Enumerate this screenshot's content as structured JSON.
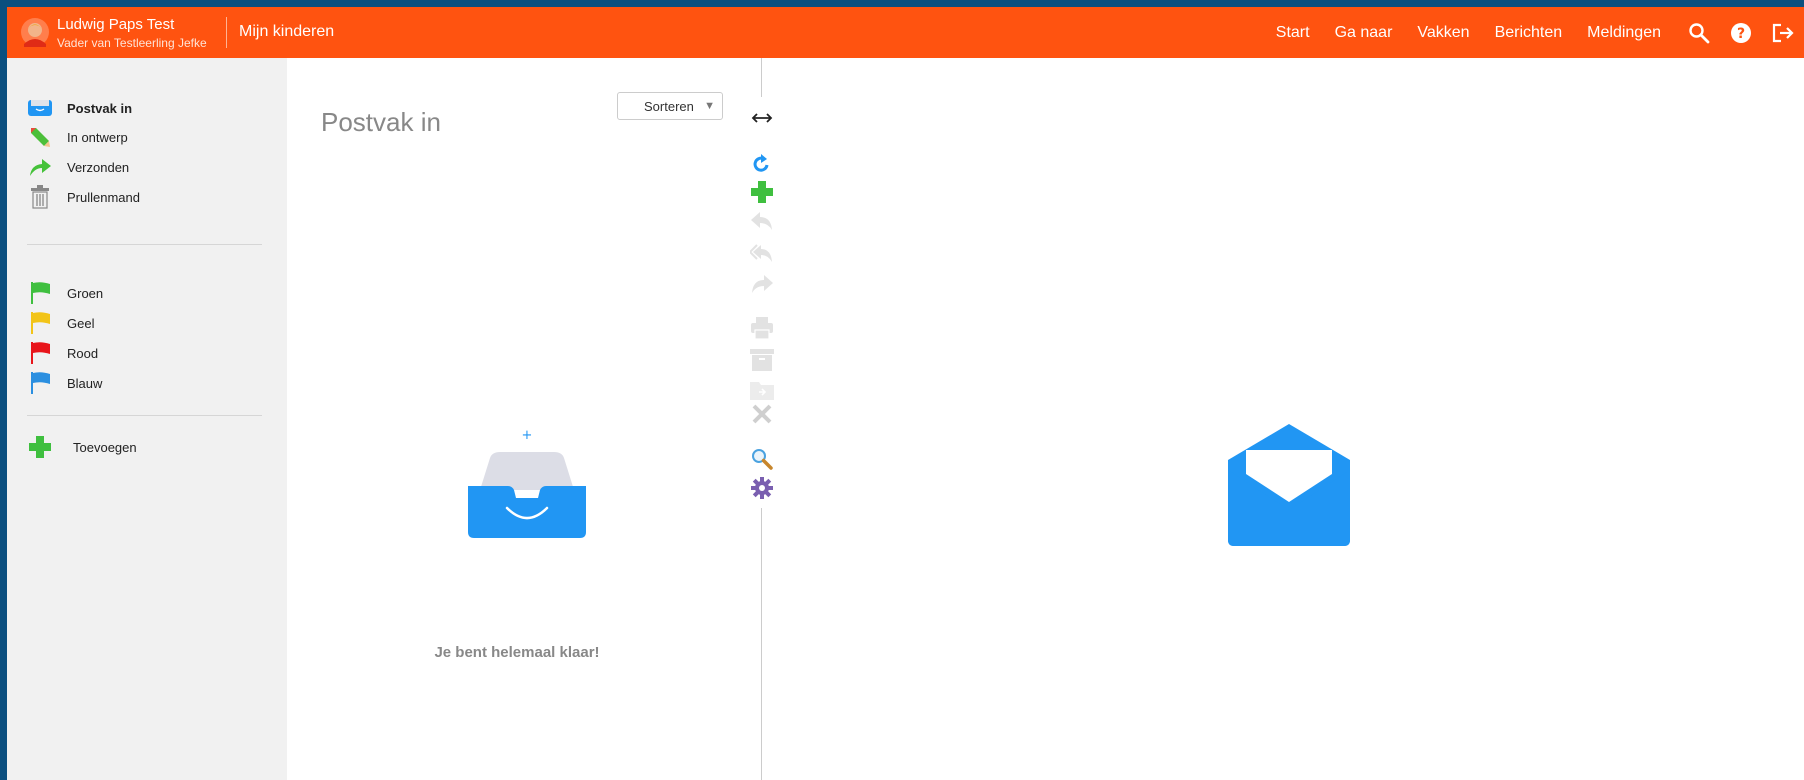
{
  "header": {
    "user_name": "Ludwig Paps Test",
    "user_role": "Vader van Testleerling Jefke",
    "kids_link": "Mijn kinderen",
    "nav": [
      "Start",
      "Ga naar",
      "Vakken",
      "Berichten",
      "Meldingen"
    ],
    "icons": [
      "search-icon",
      "help-icon",
      "logout-icon"
    ]
  },
  "sidebar": {
    "folders": [
      {
        "label": "Postvak in",
        "icon": "inbox-icon",
        "active": true
      },
      {
        "label": "In ontwerp",
        "icon": "pencil-icon"
      },
      {
        "label": "Verzonden",
        "icon": "send-arrow-icon"
      },
      {
        "label": "Prullenmand",
        "icon": "trash-icon"
      }
    ],
    "flags": [
      {
        "label": "Groen",
        "color": "#3fbf3f"
      },
      {
        "label": "Geel",
        "color": "#f2c418"
      },
      {
        "label": "Rood",
        "color": "#e8151b"
      },
      {
        "label": "Blauw",
        "color": "#2b8fe0"
      }
    ],
    "add_label": "Toevoegen"
  },
  "list": {
    "title": "Postvak in",
    "sort_label": "Sorteren",
    "empty_message": "Je bent helemaal klaar!"
  },
  "toolbar": {
    "tools": [
      "expand-arrows-icon",
      "refresh-icon",
      "new-message-icon",
      "reply-icon",
      "reply-all-icon",
      "forward-icon",
      "print-icon",
      "archive-icon",
      "move-icon",
      "delete-icon",
      "search-zoom-icon",
      "settings-gear-icon"
    ]
  },
  "colors": {
    "brand": "#ff5310",
    "accent": "#2196f3",
    "add_green": "#3fbf3f"
  }
}
